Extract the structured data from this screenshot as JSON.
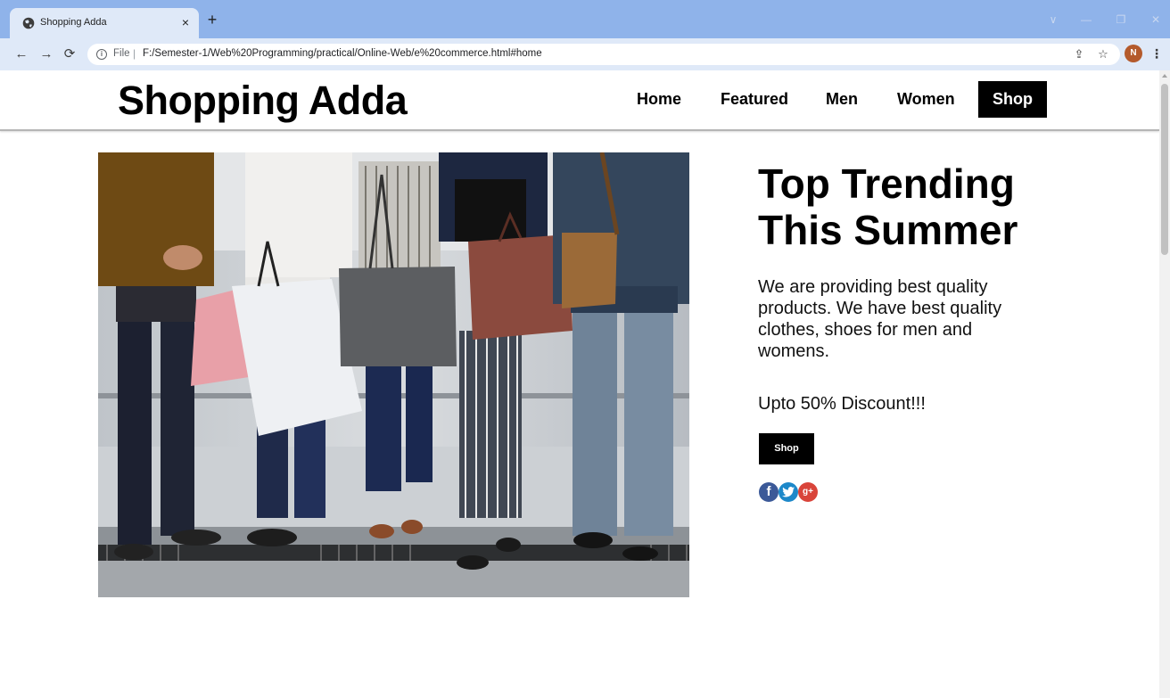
{
  "browser": {
    "tab": {
      "title": "Shopping Adda",
      "favicon": "globe-icon"
    },
    "new_tab_label": "+",
    "close_tab_label": "×",
    "window_controls": {
      "tab_search": "∨",
      "minimize": "—",
      "restore": "❐",
      "close": "✕"
    },
    "address": {
      "scheme": "File",
      "url": "F:/Semester-1/Web%20Programming/practical/Online-Web/e%20commerce.html#home"
    },
    "nav_icons": {
      "back": "back-arrow-icon",
      "forward": "forward-arrow-icon",
      "reload": "reload-icon"
    },
    "profile_initial": "N"
  },
  "site": {
    "brand": "Shopping Adda",
    "nav": [
      {
        "label": "Home",
        "active": false
      },
      {
        "label": "Featured",
        "active": false
      },
      {
        "label": "Men",
        "active": false
      },
      {
        "label": "Women",
        "active": false
      },
      {
        "label": "Shop",
        "active": true
      }
    ]
  },
  "hero": {
    "title": "Top Trending This Summer",
    "description": "We are providing best quality products. We have best quality clothes, shoes for men and womens.",
    "discount": "Upto 50% Discount!!!",
    "cta_label": "Shop",
    "social": [
      {
        "name": "facebook-icon",
        "glyph": "f",
        "color": "#3b5998"
      },
      {
        "name": "twitter-icon",
        "glyph": "t",
        "color": "#1d88c9"
      },
      {
        "name": "google-plus-icon",
        "glyph": "g+",
        "color": "#d9443a"
      }
    ]
  },
  "colors": {
    "tabstrip": "#8fb3ea",
    "toolbar": "#dfe9f8",
    "active_nav": "#000000",
    "cta": "#000000"
  }
}
